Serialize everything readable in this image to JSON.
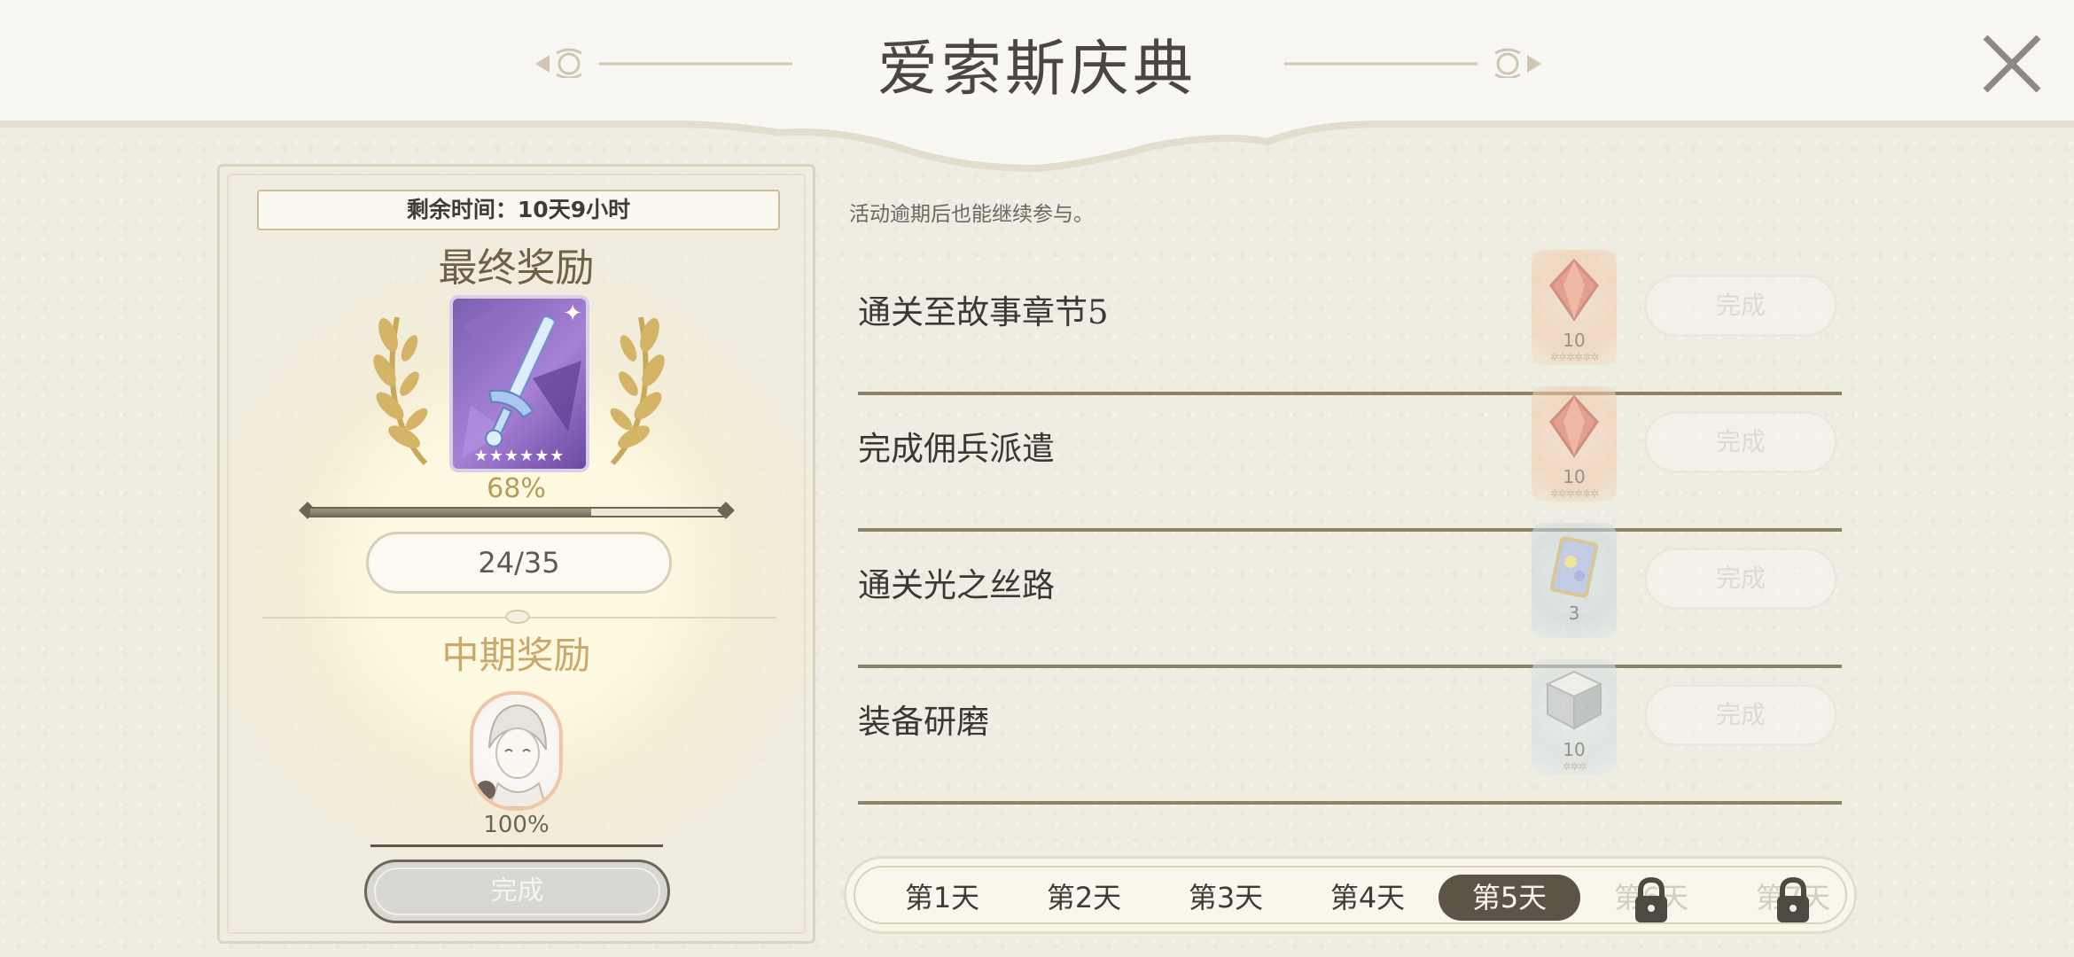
{
  "header": {
    "title": "爱索斯庆典",
    "close_icon": "close-icon"
  },
  "left": {
    "remaining_time": "剩余时间：10天9小时",
    "final_reward_title": "最终奖励",
    "final_reward_icon": "sword-card-icon",
    "final_reward_stars": "★★★★★★",
    "final_percent": "68%",
    "final_progress": 0.68,
    "count": "24/35",
    "mid_reward_title": "中期奖励",
    "mid_reward_icon": "character-portrait-icon",
    "mid_percent": "100%",
    "complete_label": "完成"
  },
  "right": {
    "note": "活动逾期后也能继续参与。",
    "tasks": [
      {
        "name": "通关至故事章节5",
        "reward_icon": "red-crystal-icon",
        "reward_count": "10",
        "reward_stars": "✲✲✲✲✲✲",
        "button": "完成"
      },
      {
        "name": "完成佣兵派遣",
        "reward_icon": "red-crystal-icon",
        "reward_count": "10",
        "reward_stars": "✲✲✲✲✲✲",
        "button": "完成"
      },
      {
        "name": "通关光之丝路",
        "reward_icon": "card-item-icon",
        "reward_count": "3",
        "reward_stars": "",
        "button": "完成"
      },
      {
        "name": "装备研磨",
        "reward_icon": "gray-cube-icon",
        "reward_count": "10",
        "reward_stars": "✲✲✲",
        "button": "完成"
      }
    ]
  },
  "days": {
    "tabs": [
      "第1天",
      "第2天",
      "第3天",
      "第4天",
      "第5天",
      "第6天",
      "第7天"
    ],
    "active_index": 4,
    "locked": [
      5,
      6
    ]
  },
  "colors": {
    "background": "#efece1",
    "active_tab": "#5b5447",
    "gold_text": "#c9a96b"
  }
}
